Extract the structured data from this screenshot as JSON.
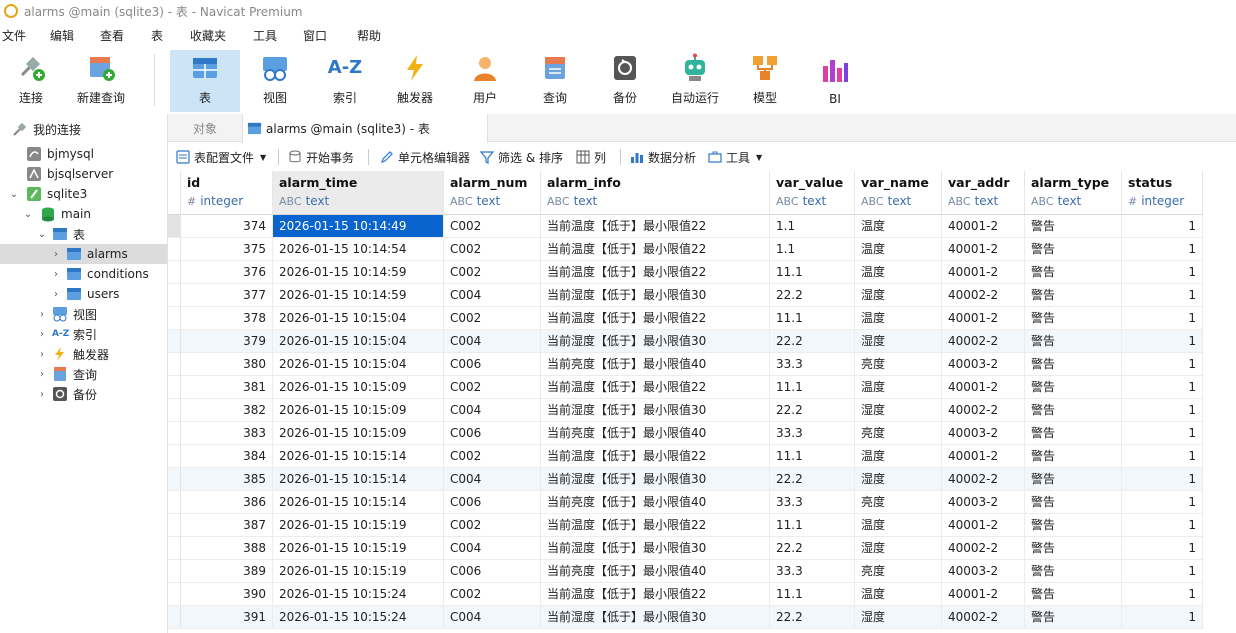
{
  "window": {
    "title": "alarms @main (sqlite3) - 表 - Navicat Premium"
  },
  "menu": [
    "文件",
    "编辑",
    "查看",
    "表",
    "收藏夹",
    "工具",
    "窗口",
    "帮助"
  ],
  "toolbar": {
    "connect": "连接",
    "new_query": "新建查询",
    "table": "表",
    "view": "视图",
    "index_icon_text": "A-Z",
    "index": "索引",
    "trigger": "触发器",
    "user": "用户",
    "query": "查询",
    "backup": "备份",
    "automation": "自动运行",
    "model": "模型",
    "bi": "BI"
  },
  "sidebar": {
    "root": "我的连接",
    "conn1": "bjmysql",
    "conn2": "bjsqlserver",
    "conn3": "sqlite3",
    "db": "main",
    "tables_group": "表",
    "table1": "alarms",
    "table2": "conditions",
    "table3": "users",
    "views": "视图",
    "indexes": "索引",
    "triggers": "触发器",
    "queries": "查询",
    "backups": "备份",
    "az_text": "A-Z"
  },
  "tabs": {
    "objects": "对象",
    "active": "alarms @main (sqlite3) - 表"
  },
  "subtoolbar": {
    "table_profile": "表配置文件",
    "begin_tx": "开始事务",
    "cell_editor": "单元格编辑器",
    "filter_sort": "筛选 & 排序",
    "columns": "列",
    "data_analysis": "数据分析",
    "tools": "工具"
  },
  "columns": [
    {
      "name": "id",
      "type": "integer",
      "sym": "#"
    },
    {
      "name": "alarm_time",
      "type": "text",
      "sym": "ABC"
    },
    {
      "name": "alarm_num",
      "type": "text",
      "sym": "ABC"
    },
    {
      "name": "alarm_info",
      "type": "text",
      "sym": "ABC"
    },
    {
      "name": "var_value",
      "type": "text",
      "sym": "ABC"
    },
    {
      "name": "var_name",
      "type": "text",
      "sym": "ABC"
    },
    {
      "name": "var_addr",
      "type": "text",
      "sym": "ABC"
    },
    {
      "name": "alarm_type",
      "type": "text",
      "sym": "ABC"
    },
    {
      "name": "status",
      "type": "integer",
      "sym": "#"
    }
  ],
  "rows": [
    [
      "374",
      "2026-01-15 10:14:49",
      "C002",
      "当前温度【低于】最小限值22",
      "1.1",
      "温度",
      "40001-2",
      "警告",
      "1"
    ],
    [
      "375",
      "2026-01-15 10:14:54",
      "C002",
      "当前温度【低于】最小限值22",
      "1.1",
      "温度",
      "40001-2",
      "警告",
      "1"
    ],
    [
      "376",
      "2026-01-15 10:14:59",
      "C002",
      "当前温度【低于】最小限值22",
      "11.1",
      "温度",
      "40001-2",
      "警告",
      "1"
    ],
    [
      "377",
      "2026-01-15 10:14:59",
      "C004",
      "当前湿度【低于】最小限值30",
      "22.2",
      "湿度",
      "40002-2",
      "警告",
      "1"
    ],
    [
      "378",
      "2026-01-15 10:15:04",
      "C002",
      "当前温度【低于】最小限值22",
      "11.1",
      "温度",
      "40001-2",
      "警告",
      "1"
    ],
    [
      "379",
      "2026-01-15 10:15:04",
      "C004",
      "当前湿度【低于】最小限值30",
      "22.2",
      "湿度",
      "40002-2",
      "警告",
      "1"
    ],
    [
      "380",
      "2026-01-15 10:15:04",
      "C006",
      "当前亮度【低于】最小限值40",
      "33.3",
      "亮度",
      "40003-2",
      "警告",
      "1"
    ],
    [
      "381",
      "2026-01-15 10:15:09",
      "C002",
      "当前温度【低于】最小限值22",
      "11.1",
      "温度",
      "40001-2",
      "警告",
      "1"
    ],
    [
      "382",
      "2026-01-15 10:15:09",
      "C004",
      "当前湿度【低于】最小限值30",
      "22.2",
      "湿度",
      "40002-2",
      "警告",
      "1"
    ],
    [
      "383",
      "2026-01-15 10:15:09",
      "C006",
      "当前亮度【低于】最小限值40",
      "33.3",
      "亮度",
      "40003-2",
      "警告",
      "1"
    ],
    [
      "384",
      "2026-01-15 10:15:14",
      "C002",
      "当前温度【低于】最小限值22",
      "11.1",
      "温度",
      "40001-2",
      "警告",
      "1"
    ],
    [
      "385",
      "2026-01-15 10:15:14",
      "C004",
      "当前湿度【低于】最小限值30",
      "22.2",
      "湿度",
      "40002-2",
      "警告",
      "1"
    ],
    [
      "386",
      "2026-01-15 10:15:14",
      "C006",
      "当前亮度【低于】最小限值40",
      "33.3",
      "亮度",
      "40003-2",
      "警告",
      "1"
    ],
    [
      "387",
      "2026-01-15 10:15:19",
      "C002",
      "当前温度【低于】最小限值22",
      "11.1",
      "温度",
      "40001-2",
      "警告",
      "1"
    ],
    [
      "388",
      "2026-01-15 10:15:19",
      "C004",
      "当前湿度【低于】最小限值30",
      "22.2",
      "湿度",
      "40002-2",
      "警告",
      "1"
    ],
    [
      "389",
      "2026-01-15 10:15:19",
      "C006",
      "当前亮度【低于】最小限值40",
      "33.3",
      "亮度",
      "40003-2",
      "警告",
      "1"
    ],
    [
      "390",
      "2026-01-15 10:15:24",
      "C002",
      "当前温度【低于】最小限值22",
      "11.1",
      "温度",
      "40001-2",
      "警告",
      "1"
    ],
    [
      "391",
      "2026-01-15 10:15:24",
      "C004",
      "当前湿度【低于】最小限值30",
      "22.2",
      "湿度",
      "40002-2",
      "警告",
      "1"
    ]
  ]
}
